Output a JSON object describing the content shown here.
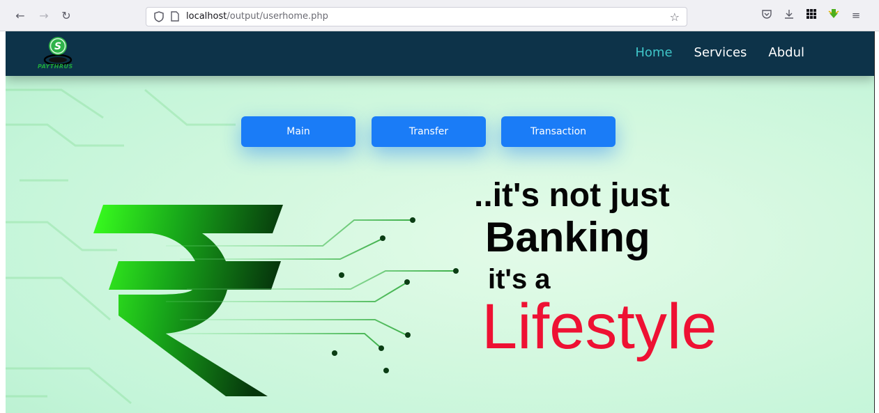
{
  "browser": {
    "url_host": "localhost",
    "url_path": "/output/userhome.php"
  },
  "navbar": {
    "logo_text": "PAYTHRUS",
    "links": [
      {
        "label": "Home",
        "active": true
      },
      {
        "label": "Services",
        "active": false
      },
      {
        "label": "Abdul",
        "active": false
      }
    ]
  },
  "actions": {
    "main_label": "Main",
    "transfer_label": "Transfer",
    "transaction_label": "Transaction"
  },
  "hero": {
    "line1": "..it's not just",
    "line2": "Banking",
    "line3": "it's a",
    "line4": "Lifestyle"
  },
  "colors": {
    "navbar_bg": "#0d3349",
    "active_link": "#3fc6c9",
    "button_bg": "#1a7cf7",
    "lifestyle_red": "#ee1133"
  }
}
